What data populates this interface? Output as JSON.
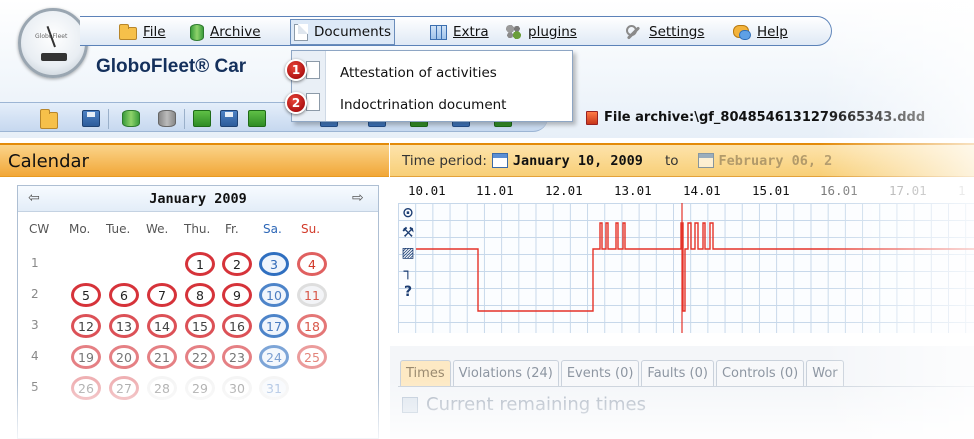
{
  "app": {
    "logo_brand": "GloboFleet",
    "title": "GloboFleet® Car",
    "file_archive_label": "File archive:\\gf_8048546131279665343.ddd"
  },
  "menu": {
    "items": [
      {
        "label": "File",
        "icon": "folder-icon"
      },
      {
        "label": "Archive",
        "icon": "database-icon"
      },
      {
        "label": "Documents",
        "icon": "document-icon",
        "active": true
      },
      {
        "label": "Extra",
        "icon": "grid-icon"
      },
      {
        "label": "plugins",
        "icon": "puzzle-icon"
      },
      {
        "label": "Settings",
        "icon": "wrench-icon"
      },
      {
        "label": "Help",
        "icon": "help-icon"
      }
    ]
  },
  "dropdown": {
    "items": [
      {
        "label": "Attestation of activities",
        "badge": "1"
      },
      {
        "label": "Indoctrination document",
        "badge": "2"
      }
    ]
  },
  "calendar": {
    "header": "Calendar",
    "month": "January 2009",
    "prev_arrow": "⇦",
    "next_arrow": "⇨",
    "columns": [
      "CW",
      "Mo.",
      "Tue.",
      "We.",
      "Thu.",
      "Fr.",
      "Sa.",
      "Su."
    ],
    "weeks": [
      {
        "cw": "1",
        "days": [
          "",
          "",
          "",
          "1",
          "2",
          "3",
          "4"
        ]
      },
      {
        "cw": "2",
        "days": [
          "5",
          "6",
          "7",
          "8",
          "9",
          "10",
          "11"
        ]
      },
      {
        "cw": "3",
        "days": [
          "12",
          "13",
          "14",
          "15",
          "16",
          "17",
          "18"
        ]
      },
      {
        "cw": "4",
        "days": [
          "19",
          "20",
          "21",
          "22",
          "23",
          "24",
          "25"
        ]
      },
      {
        "cw": "5",
        "days": [
          "26",
          "27",
          "28",
          "29",
          "30",
          "31",
          ""
        ]
      }
    ]
  },
  "time_period": {
    "label": "Time period:",
    "from": "January 10, 2009",
    "to_label": "to",
    "to": "February 06, 2"
  },
  "activity_chart": {
    "x_labels": [
      "10.01",
      "11.01",
      "12.01",
      "13.01",
      "14.01",
      "15.01",
      "16.01",
      "17.01",
      "1"
    ],
    "status_symbols": [
      "⊙",
      "⚒",
      "▨",
      "┐",
      "?"
    ]
  },
  "tabs": [
    {
      "label": "Times",
      "active": true
    },
    {
      "label": "Violations (24)"
    },
    {
      "label": "Events (0)"
    },
    {
      "label": "Faults (0)"
    },
    {
      "label": "Controls (0)"
    },
    {
      "label": "Wor"
    }
  ],
  "remaining": {
    "label": "Current remaining times"
  },
  "colors": {
    "accent_orange": "#f1a738",
    "menu_border": "#5b82b8",
    "sunday_red": "#d23a2a",
    "saturday_blue": "#2d67b7",
    "badge_red": "#b01212"
  }
}
